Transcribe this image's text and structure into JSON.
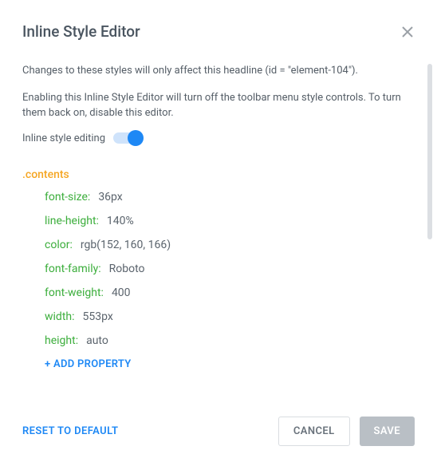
{
  "header": {
    "title": "Inline Style Editor"
  },
  "descriptions": {
    "line1": "Changes to these styles will only affect this headline (id = \"element-104\").",
    "line2": "Enabling this Inline Style Editor will turn off the toolbar menu style controls. To turn them back on, disable this editor."
  },
  "toggle": {
    "label": "Inline style editing",
    "on": true
  },
  "editor": {
    "selector": ".contents",
    "properties": [
      {
        "name": "font-size",
        "value": "36px"
      },
      {
        "name": "line-height",
        "value": "140%"
      },
      {
        "name": "color",
        "value": "rgb(152, 160, 166)"
      },
      {
        "name": "font-family",
        "value": "Roboto"
      },
      {
        "name": "font-weight",
        "value": "400"
      },
      {
        "name": "width",
        "value": "553px"
      },
      {
        "name": "height",
        "value": "auto"
      }
    ],
    "add_property_label": "+ ADD PROPERTY"
  },
  "footer": {
    "reset_label": "RESET TO DEFAULT",
    "cancel_label": "CANCEL",
    "save_label": "SAVE"
  }
}
